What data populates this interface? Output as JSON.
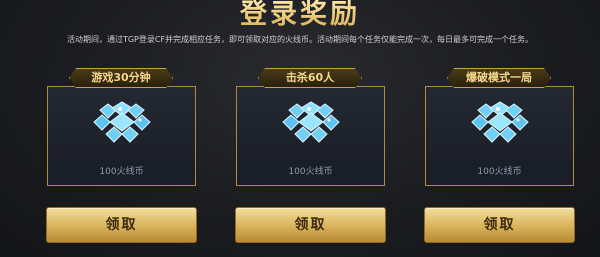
{
  "header": {
    "title": "登录奖励",
    "description": "活动期间，通过TGP登录CF并完成相应任务，即可领取对应的火线币。活动期间每个任务仅能完成一次，每日最多可完成一个任务。"
  },
  "tasks": [
    {
      "label": "游戏30分钟",
      "reward": "100火线币",
      "button": "领取",
      "icon": "diamond-cluster-icon"
    },
    {
      "label": "击杀60人",
      "reward": "100火线币",
      "button": "领取",
      "icon": "diamond-cluster-icon"
    },
    {
      "label": "爆破模式一局",
      "reward": "100火线币",
      "button": "领取",
      "icon": "diamond-cluster-icon"
    }
  ],
  "colors": {
    "gold": "#d9b15b",
    "background": "#1b1c1f",
    "gem": "#7fd8ff"
  }
}
